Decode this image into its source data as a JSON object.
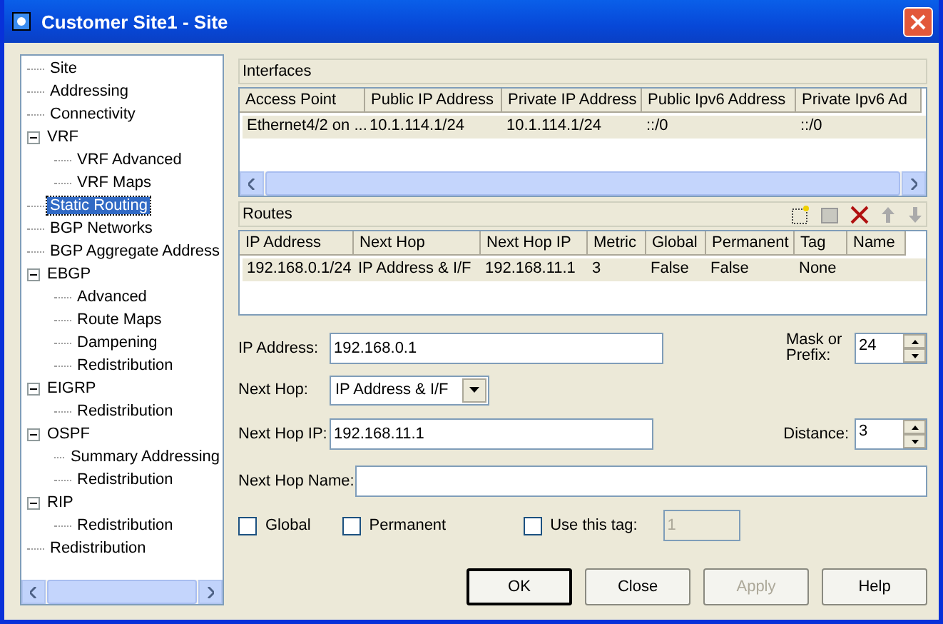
{
  "window": {
    "title": "Customer Site1 - Site"
  },
  "tree": {
    "items": [
      {
        "label": "Site",
        "selected": false
      },
      {
        "label": "Addressing",
        "selected": false
      },
      {
        "label": "Connectivity",
        "selected": false
      },
      {
        "label": "VRF",
        "selected": false,
        "expanded": true,
        "children": [
          {
            "label": "VRF Advanced",
            "selected": false
          },
          {
            "label": "VRF Maps",
            "selected": false
          }
        ]
      },
      {
        "label": "Static Routing",
        "selected": true
      },
      {
        "label": "BGP Networks",
        "selected": false
      },
      {
        "label": "BGP Aggregate Address",
        "selected": false
      },
      {
        "label": "EBGP",
        "selected": false,
        "expanded": true,
        "children": [
          {
            "label": "Advanced",
            "selected": false
          },
          {
            "label": "Route Maps",
            "selected": false
          },
          {
            "label": "Dampening",
            "selected": false
          },
          {
            "label": "Redistribution",
            "selected": false
          }
        ]
      },
      {
        "label": "EIGRP",
        "selected": false,
        "expanded": true,
        "children": [
          {
            "label": "Redistribution",
            "selected": false
          }
        ]
      },
      {
        "label": "OSPF",
        "selected": false,
        "expanded": true,
        "children": [
          {
            "label": "Summary Addressing",
            "selected": false
          },
          {
            "label": "Redistribution",
            "selected": false
          }
        ]
      },
      {
        "label": "RIP",
        "selected": false,
        "expanded": true,
        "children": [
          {
            "label": "Redistribution",
            "selected": false
          }
        ]
      },
      {
        "label": "Redistribution",
        "selected": false
      }
    ]
  },
  "interfaces": {
    "title": "Interfaces",
    "columns": [
      "Access Point",
      "Public IP Address",
      "Private IP Address",
      "Public Ipv6 Address",
      "Private Ipv6 Ad"
    ],
    "rows": [
      {
        "cells": [
          "Ethernet4/2 on ...",
          "10.1.114.1/24",
          "10.1.114.1/24",
          "::/0",
          "::/0"
        ],
        "selected": true
      }
    ]
  },
  "routes": {
    "title": "Routes",
    "columns": [
      "IP Address",
      "Next Hop",
      "Next Hop IP",
      "Metric",
      "Global",
      "Permanent",
      "Tag",
      "Name"
    ],
    "rows": [
      {
        "cells": [
          "192.168.0.1/24",
          "IP Address & I/F",
          "192.168.11.1",
          "3",
          "False",
          "False",
          "None",
          ""
        ],
        "selected": true
      }
    ]
  },
  "form": {
    "ip_address": {
      "label": "IP Address:",
      "value": "192.168.0.1"
    },
    "mask": {
      "label": "Mask or Prefix:",
      "value": "24"
    },
    "next_hop": {
      "label": "Next Hop:",
      "value": "IP Address & I/F"
    },
    "next_hop_ip": {
      "label": "Next Hop IP:",
      "value": "192.168.11.1"
    },
    "distance": {
      "label": "Distance:",
      "value": "3"
    },
    "next_hop_name": {
      "label": "Next Hop Name:"
    },
    "checkboxes": [
      {
        "label": "Global",
        "checked": false
      },
      {
        "label": "Permanent",
        "checked": false
      }
    ],
    "use_tag": {
      "label": "Use this tag:",
      "checked": false,
      "value": "1",
      "disabled": true
    }
  },
  "buttons": [
    {
      "label": "OK",
      "disabled": false,
      "default": true
    },
    {
      "label": "Close",
      "disabled": false,
      "default": false
    },
    {
      "label": "Apply",
      "disabled": true,
      "default": false
    },
    {
      "label": "Help",
      "disabled": false,
      "default": false
    }
  ]
}
